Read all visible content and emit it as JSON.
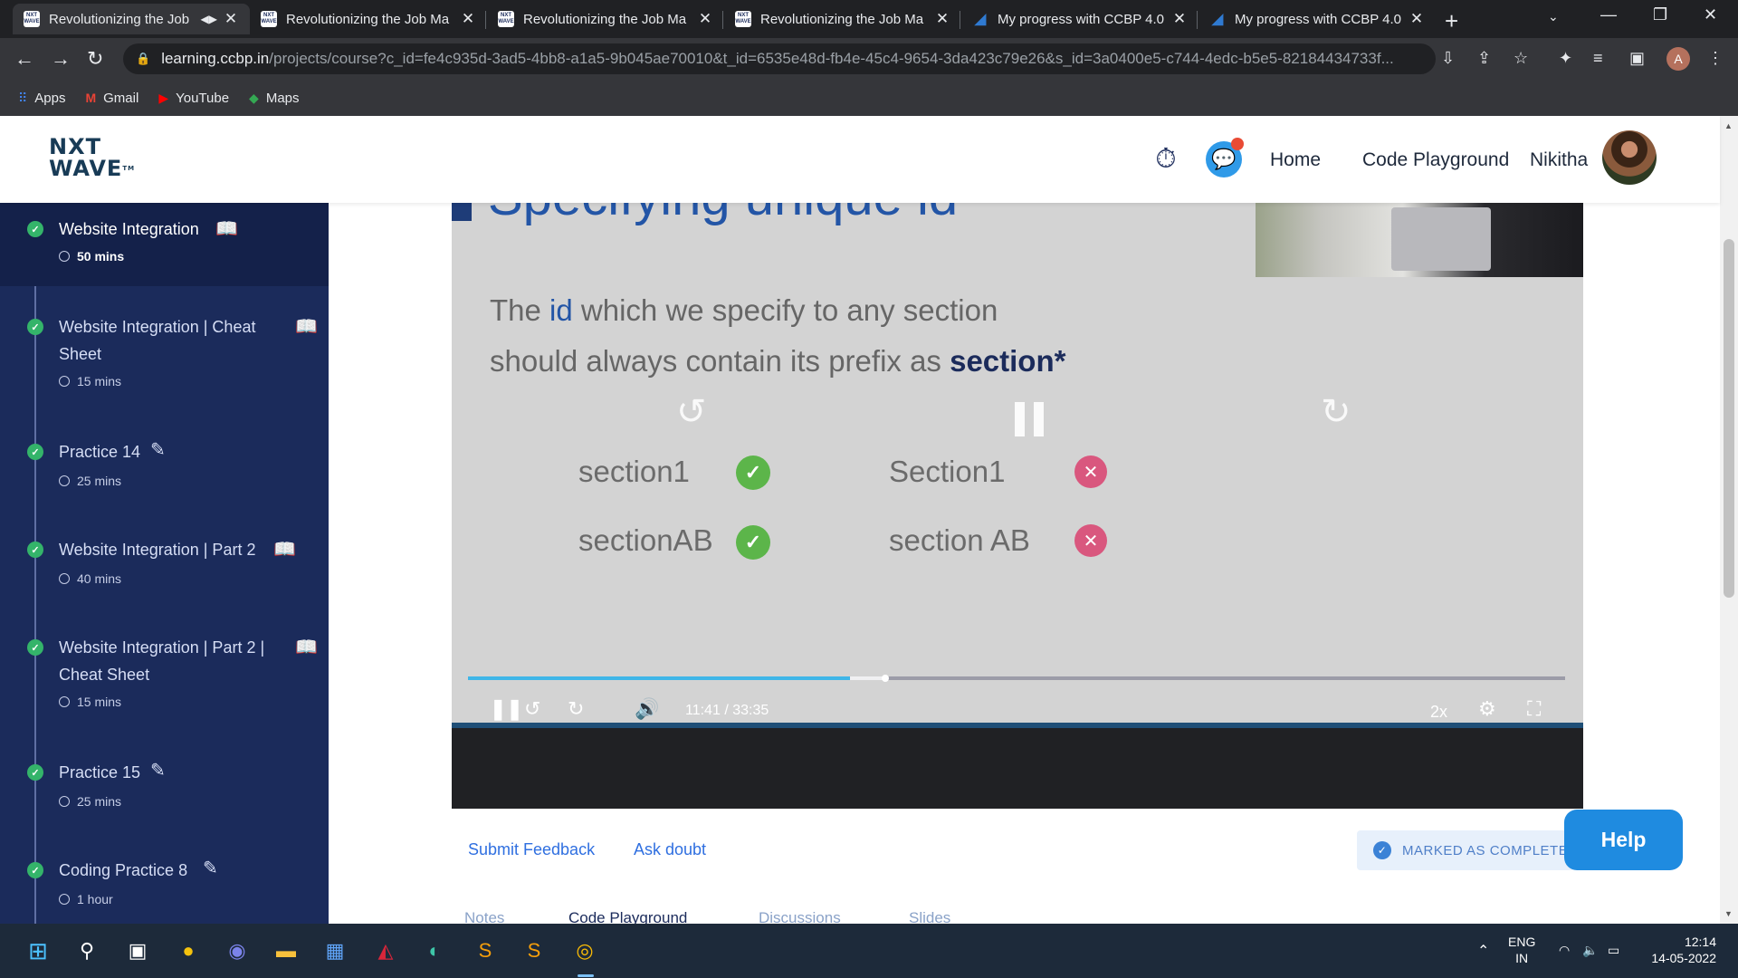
{
  "browser": {
    "tabs": [
      {
        "title": "Revolutionizing the Job",
        "favicon": "nxtwave-icon",
        "active": true,
        "audio": true
      },
      {
        "title": "Revolutionizing the Job Ma",
        "favicon": "nxtwave-icon"
      },
      {
        "title": "Revolutionizing the Job Ma",
        "favicon": "nxtwave-icon"
      },
      {
        "title": "Revolutionizing the Job Ma",
        "favicon": "nxtwave-icon"
      },
      {
        "title": "My progress with CCBP 4.0",
        "favicon": "progress-chart-icon"
      },
      {
        "title": "My progress with CCBP 4.0",
        "favicon": "progress-chart-icon"
      }
    ],
    "url_host": "learning.ccbp.in",
    "url_path": "/projects/course?c_id=fe4c935d-3ad5-4bb8-a1a5-9b045ae70010&t_id=6535e48d-fb4e-45c4-9654-3da423c79e26&s_id=3a0400e5-c744-4edc-b5e5-82184434733f...",
    "profile_initial": "A",
    "bookmarks": [
      {
        "label": "Apps",
        "icon": "apps-grid-icon"
      },
      {
        "label": "Gmail",
        "icon": "gmail-icon"
      },
      {
        "label": "YouTube",
        "icon": "youtube-icon"
      },
      {
        "label": "Maps",
        "icon": "maps-icon"
      }
    ]
  },
  "header": {
    "logo_line1": "NXT",
    "logo_line2": "WAVE",
    "logo_tm": "TM",
    "nav": [
      "Home",
      "Code Playground"
    ],
    "user_name": "Nikitha"
  },
  "sidebar": {
    "items": [
      {
        "title": "Website Integration",
        "duration": "50 mins",
        "icon": "book-icon",
        "active": true
      },
      {
        "title": "Website Integration | Cheat Sheet",
        "duration": "15 mins",
        "icon": "book-icon"
      },
      {
        "title": "Practice 14",
        "duration": "25 mins",
        "icon": "pencil-icon"
      },
      {
        "title": "Website Integration | Part 2",
        "duration": "40 mins",
        "icon": "book-icon"
      },
      {
        "title": "Website Integration | Part 2 | Cheat Sheet",
        "duration": "15 mins",
        "icon": "book-icon"
      },
      {
        "title": "Practice 15",
        "duration": "25 mins",
        "icon": "pencil-icon"
      },
      {
        "title": "Coding Practice 8",
        "duration": "1 hour",
        "icon": "pencil-icon"
      }
    ]
  },
  "video": {
    "slide_heading": "Specifying unique id",
    "line1_pre": "The ",
    "line1_hl": "id",
    "line1_post": " which we specify to any section",
    "line2_pre": "should always contain its prefix as ",
    "line2_bold": "section*",
    "examples": {
      "valid": [
        "section1",
        "sectionAB"
      ],
      "invalid": [
        "Section1",
        "section AB"
      ]
    },
    "current_time": "11:41",
    "duration": "33:35",
    "time_separator": "/",
    "progress_fraction": 0.348,
    "buffered_fraction": 0.38,
    "speed": "2x",
    "skip_seconds": "10"
  },
  "actions": {
    "submit_feedback": "Submit Feedback",
    "ask_doubt": "Ask doubt",
    "marked_complete": "MARKED AS COMPLETE",
    "help": "Help"
  },
  "subtabs": [
    "Notes",
    "Code Playground",
    "Discussions",
    "Slides"
  ],
  "taskbar": {
    "lang_line1": "ENG",
    "lang_line2": "IN",
    "time": "12:14",
    "date": "14-05-2022"
  },
  "colors": {
    "sidebar_bg": "#1b2b5b",
    "accent_blue": "#2f6fe0",
    "complete_green": "#34b46a",
    "progress_blue": "#3fb6e8"
  }
}
